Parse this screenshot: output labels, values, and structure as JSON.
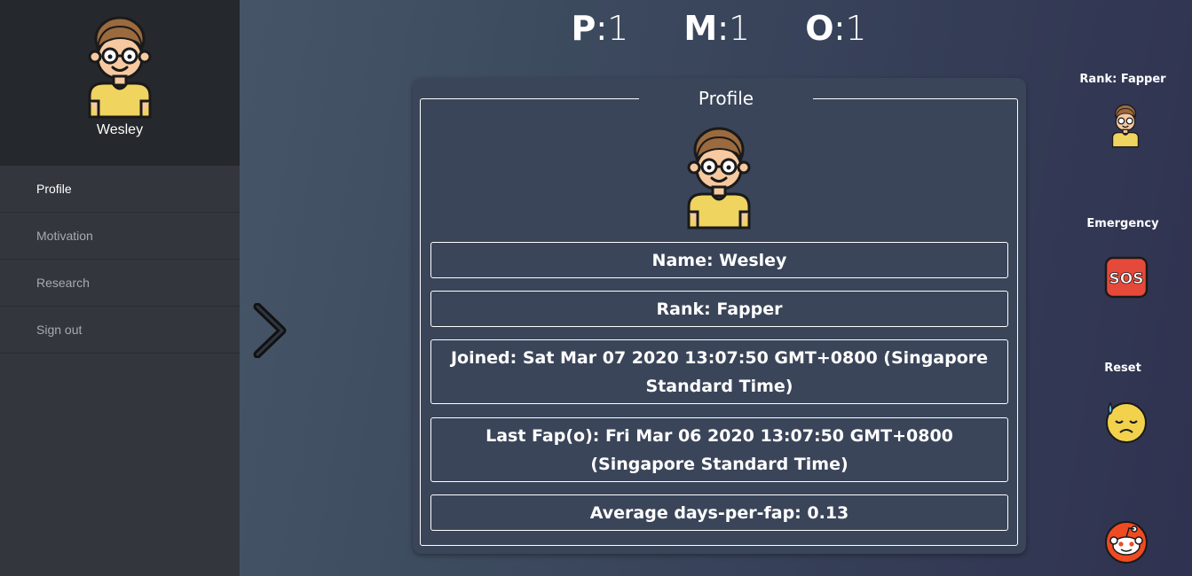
{
  "sidebar": {
    "username": "Wesley",
    "items": [
      {
        "label": "Profile"
      },
      {
        "label": "Motivation"
      },
      {
        "label": "Research"
      },
      {
        "label": "Sign out"
      }
    ]
  },
  "counters": {
    "p": {
      "key": "P",
      "value": "1"
    },
    "m": {
      "key": "M",
      "value": "1"
    },
    "o": {
      "key": "O",
      "value": "1"
    }
  },
  "profile": {
    "title": "Profile",
    "name": "Name: Wesley",
    "rank": "Rank: Fapper",
    "joined": "Joined: Sat Mar 07 2020 13:07:50 GMT+0800 (Singapore Standard Time)",
    "last_fap": "Last Fap(o): Fri Mar 06 2020 13:07:50 GMT+0800 (Singapore Standard Time)",
    "average": "Average days-per-fap: 0.13"
  },
  "right_panel": {
    "rank_label": "Rank: Fapper",
    "emergency_label": "Emergency",
    "sos_text": "SOS",
    "reset_label": "Reset"
  },
  "icons": {
    "avatar": "nerd-avatar-icon",
    "arrow": "chevron-right-icon",
    "sos": "sos-icon",
    "reset": "sad-sweat-emoji-icon",
    "reddit": "reddit-icon"
  }
}
